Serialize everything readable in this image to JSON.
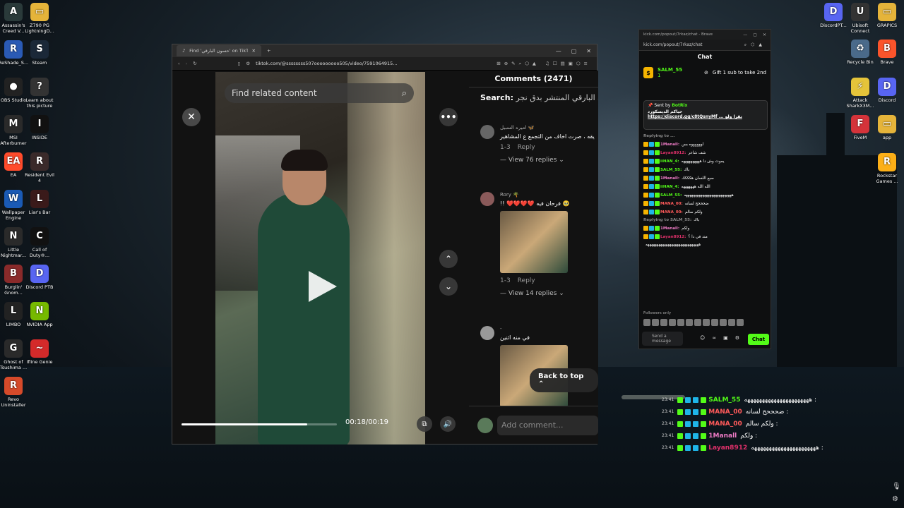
{
  "desktop_left": [
    {
      "label": "Assassin's Creed V...",
      "color": "#2a3a3a",
      "glyph": "A"
    },
    {
      "label": "Z790 PG LightningD...",
      "color": "#e5b43a",
      "glyph": "▭"
    },
    {
      "label": "ReShade_S...",
      "color": "#2a5ab5",
      "glyph": "R"
    },
    {
      "label": "Steam",
      "color": "#1b2838",
      "glyph": "S"
    },
    {
      "label": "OBS Studio",
      "color": "#222",
      "glyph": "●"
    },
    {
      "label": "Learn about this picture",
      "color": "#333",
      "glyph": "?"
    },
    {
      "label": "MSI Afterburner",
      "color": "#2a2a2a",
      "glyph": "M"
    },
    {
      "label": "INSIDE",
      "color": "#111",
      "glyph": "I"
    },
    {
      "label": "EA",
      "color": "#ff4b2b",
      "glyph": "EA"
    },
    {
      "label": "Resident Evil 4",
      "color": "#3a2a2a",
      "glyph": "R"
    },
    {
      "label": "Wallpaper Engine",
      "color": "#1a5ab5",
      "glyph": "W"
    },
    {
      "label": "Liar's Bar",
      "color": "#3a1a1a",
      "glyph": "L"
    },
    {
      "label": "Little Nightmar...",
      "color": "#2a2a2a",
      "glyph": "N"
    },
    {
      "label": "Call of Duty®...",
      "color": "#111",
      "glyph": "C"
    },
    {
      "label": "Burglin' Gnom...",
      "color": "#8a2a2a",
      "glyph": "B"
    },
    {
      "label": "Discord PTB",
      "color": "#5865f2",
      "glyph": "D"
    },
    {
      "label": "LIMBO",
      "color": "#222",
      "glyph": "L"
    },
    {
      "label": "NVIDIA App",
      "color": "#76b900",
      "glyph": "N"
    },
    {
      "label": "Ghost of Tsushima ...",
      "color": "#2a2a2a",
      "glyph": "G"
    },
    {
      "label": "Ifline Genie",
      "color": "#d42a2a",
      "glyph": "~"
    },
    {
      "label": "Revo Uninstaller",
      "color": "#d64a2a",
      "glyph": "R"
    }
  ],
  "desktop_right": [
    {
      "label": "DiscordPT...",
      "color": "#5865f2",
      "glyph": "D"
    },
    {
      "label": "Ubisoft Connect",
      "color": "#333",
      "glyph": "U"
    },
    {
      "label": "GRAPICS",
      "color": "#e5b43a",
      "glyph": "▭"
    },
    {
      "label": "Recycle Bin",
      "color": "#4a6a8a",
      "glyph": "♻"
    },
    {
      "label": "Brave",
      "color": "#fb542b",
      "glyph": "B"
    },
    {
      "label": "Attack SharkX3M...",
      "color": "#e5c43a",
      "glyph": "⚡"
    },
    {
      "label": "Discord",
      "color": "#5865f2",
      "glyph": "D"
    },
    {
      "label": "FiveM",
      "color": "#d4333a",
      "glyph": "F"
    },
    {
      "label": "app",
      "color": "#e5b43a",
      "glyph": "▭"
    },
    {
      "label": "Rockstar Games ...",
      "color": "#fcaf17",
      "glyph": "R"
    }
  ],
  "browser": {
    "tab_title": "Find 'حسون البارقي' on TikTok",
    "url": "tiktok.com/@ssssssss507ooooooooo505/video/7591064915...",
    "search_placeholder": "Find related content",
    "time": "00:18/00:19",
    "progress": 0.81,
    "comments_title": "Comments (2471)",
    "search_label": "Search:",
    "search_query": "ع حسون البارقي المنتشر بدق نجر",
    "back_to_top": "Back to top",
    "add_comment": "Add comment...",
    "comments": [
      {
        "name": "اميره السبيل 🦋",
        "text": "يقه ، صرت اخاف من التجمع ع المشاهير",
        "likes": "1-3",
        "reply": "Reply",
        "replies": "View 76 replies"
      },
      {
        "name": "Rory 🌴",
        "text": "!! ❤️❤️❤️❤️ فرحان فيه 🥹",
        "likes": "1-3",
        "reply": "Reply",
        "replies": "View 14 replies"
      },
      {
        "name": "-",
        "text": "في منه اثنين"
      }
    ]
  },
  "kick": {
    "title": "kick.com/popout/7rkaz/chat - Brave",
    "url": "kick.com/popout/7rkaz/chat",
    "header": "Chat",
    "gift_user": "SALM_55",
    "gift_text": "Gift 1 sub to take 2nd",
    "gift_count": "1",
    "pinned_by": "Sent by",
    "pinned_user": "BotRix",
    "pinned_text": "حياكم الديسكورد",
    "pinned_link": "https://discord.gg/c8tQsnyMf ... نقرا ولو",
    "messages": [
      {
        "user": "Replying to ...",
        "color": "#888",
        "text": ""
      },
      {
        "user": "1Manall:",
        "color": "#f07cc7",
        "text": "اووووووه بس"
      },
      {
        "user": "Layan8912:",
        "color": "#e0306a",
        "text": "شف شاعر"
      },
      {
        "user": "iiHAN_4:",
        "color": "#53fc18",
        "text": "يموت وش دا ههههههههههه"
      },
      {
        "user": "SALM_55:",
        "color": "#53fc18",
        "text": "باك"
      },
      {
        "user": "1Manall:",
        "color": "#f07cc7",
        "text": "سبع اللسان هكككك"
      },
      {
        "user": "iiHAN_4:",
        "color": "#53fc18",
        "text": "الله الله هههههههه"
      },
      {
        "user": "SALM_55:",
        "color": "#53fc18",
        "text": "ههههههههههههههههههههههههههه"
      },
      {
        "user": "MANA_00:",
        "color": "#ff5a5a",
        "text": "ضحححح لسانه"
      },
      {
        "user": "MANA_00:",
        "color": "#ff5a5a",
        "text": "ولكم سالم"
      },
      {
        "user": "Replying to SALM_55:",
        "color": "#888",
        "text": "باك"
      },
      {
        "user": "1Manall:",
        "color": "#f07cc7",
        "text": "ولكم"
      },
      {
        "user": "Layan8912:",
        "color": "#e0306a",
        "text": "مند في دا ؟"
      },
      {
        "user": "",
        "color": "#fff",
        "text": "هههههههههههههههههههههههههههههه"
      }
    ],
    "followers_only": "Followers only",
    "send_placeholder": "Send a message",
    "chat_button": "Chat"
  },
  "overlay": [
    {
      "time": "23:41",
      "user": "SALM_55",
      "color": "#53fc18",
      "text": "ههههههههههههههههههههههه :"
    },
    {
      "time": "23:41",
      "user": "MANA_00",
      "color": "#ff5a5a",
      "text": "ضحححح لسانه :"
    },
    {
      "time": "23:41",
      "user": "MANA_00",
      "color": "#ff5a5a",
      "text": "ولكم سالم :"
    },
    {
      "time": "23:41",
      "user": "1Manall",
      "color": "#f07cc7",
      "text": "ولكم :"
    },
    {
      "time": "23:41",
      "user": "Layan8912",
      "color": "#e0306a",
      "text": "ههههههههههههههههههههههه :"
    }
  ]
}
